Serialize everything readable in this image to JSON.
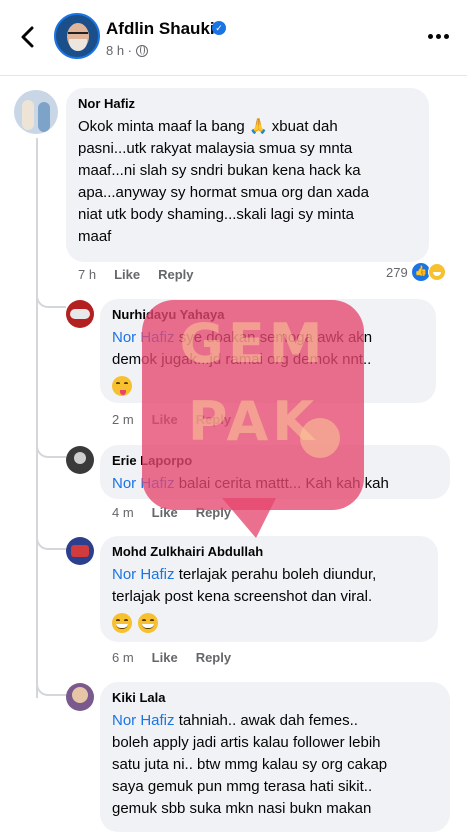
{
  "header": {
    "name": "Afdlin Shauki",
    "meta": "8 h ·"
  },
  "comments": [
    {
      "author": "Nor Hafiz",
      "lines": [
        "Okok minta maaf la bang",
        "xbuat dah",
        "pasni...utk rakyat malaysia smua sy mnta",
        "maaf...ni slah sy sndri bukan kena hack ka",
        "apa...anyway sy hormat smua org dan xada",
        "niat utk body shaming...skali lagi sy minta",
        "maaf"
      ],
      "time": "7 h",
      "like": "Like",
      "reply": "Reply",
      "reaction_count": "279"
    }
  ],
  "replies": [
    {
      "author": "Nurhidayu Yahaya",
      "mention": "Nor Hafiz",
      "lines": [
        "sye doakan semoga awk akn",
        "demok jugak...jd ramai org demok nnt.."
      ],
      "time": "2 m",
      "like": "Like",
      "reply": "Reply"
    },
    {
      "author": "Erie Laporpo",
      "mention": "Nor Hafiz",
      "lines": [
        "balai cerita mattt... Kah kah kah"
      ],
      "time": "4 m",
      "like": "Like",
      "reply": "Reply"
    },
    {
      "author": "Mohd Zulkhairi Abdullah",
      "mention": "Nor Hafiz",
      "lines": [
        "terlajak perahu boleh diundur,",
        "terlajak post kena screenshot dan viral."
      ],
      "time": "6 m",
      "like": "Like",
      "reply": "Reply"
    },
    {
      "author": "Kiki Lala",
      "mention": "Nor Hafiz",
      "lines": [
        "tahniah.. awak dah femes..",
        "boleh apply jadi artis kalau follower lebih",
        "satu juta ni.. btw mmg kalau sy org cakap",
        "saya gemuk pun mmg terasa hati sikit..",
        "gemuk sbb suka mkn nasi bukn makan"
      ]
    }
  ],
  "watermark": {
    "line1": "GEM",
    "line2": "PAK"
  },
  "colors": {
    "mention": "#1b74e4",
    "bubble": "#f0f2f5",
    "watermark": "#e6466e"
  },
  "icons": [
    "back-arrow-icon",
    "verified-icon",
    "globe-icon",
    "more-icon",
    "like-reaction-icon",
    "haha-reaction-icon"
  ]
}
